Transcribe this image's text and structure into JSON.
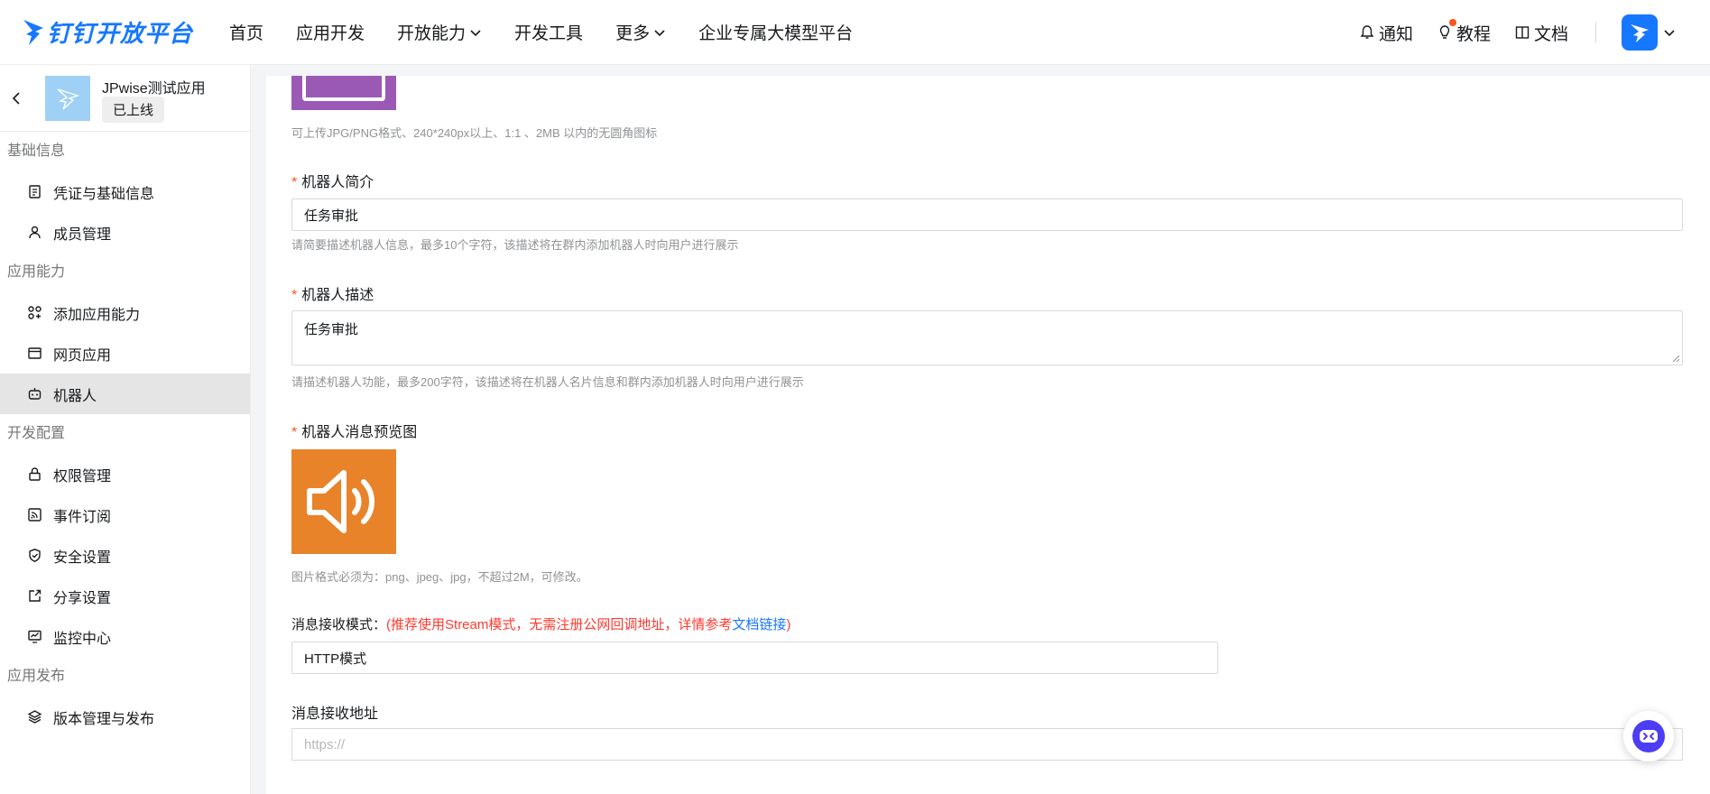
{
  "header": {
    "logo_text": "钉钉开放平台",
    "nav": [
      {
        "label": "首页"
      },
      {
        "label": "应用开发"
      },
      {
        "label": "开放能力"
      },
      {
        "label": "开发工具"
      },
      {
        "label": "更多"
      },
      {
        "label": "企业专属大模型平台"
      }
    ],
    "right": {
      "notify": "通知",
      "tutorial": "教程",
      "docs": "文档"
    }
  },
  "sidebar": {
    "app_name": "JPwise测试应用",
    "app_status": "已上线",
    "groups": [
      {
        "title": "基础信息",
        "items": [
          "凭证与基础信息",
          "成员管理"
        ]
      },
      {
        "title": "应用能力",
        "items": [
          "添加应用能力",
          "网页应用",
          "机器人"
        ]
      },
      {
        "title": "开发配置",
        "items": [
          "权限管理",
          "事件订阅",
          "安全设置",
          "分享设置",
          "监控中心"
        ]
      },
      {
        "title": "应用发布",
        "items": [
          "版本管理与发布"
        ]
      }
    ],
    "active_item": "机器人"
  },
  "form": {
    "icon_hint": "可上传JPG/PNG格式、240*240px以上、1:1 、2MB 以内的无圆角图标",
    "intro_label": "机器人简介",
    "intro_value": "任务审批",
    "intro_hint": "请简要描述机器人信息，最多10个字符，该描述将在群内添加机器人时向用户进行展示",
    "desc_label": "机器人描述",
    "desc_value": "任务审批",
    "desc_hint": "请描述机器人功能，最多200字符，该描述将在机器人名片信息和群内添加机器人时向用户进行展示",
    "preview_label": "机器人消息预览图",
    "preview_hint": "图片格式必须为：png、jpeg、jpg，不超过2M，可修改。",
    "mode_label": "消息接收模式：",
    "mode_tip_open": "(",
    "mode_tip_text": "推荐使用Stream模式，无需注册公网回调地址，详情参考",
    "mode_tip_link": "文档链接",
    "mode_tip_close": ")",
    "mode_value": "HTTP模式",
    "url_label": "消息接收地址",
    "url_placeholder": "https://"
  },
  "colors": {
    "brand": "#1677ff",
    "icon_purple": "#9b59b6",
    "preview_orange": "#e8832a",
    "required": "#ff5219"
  }
}
